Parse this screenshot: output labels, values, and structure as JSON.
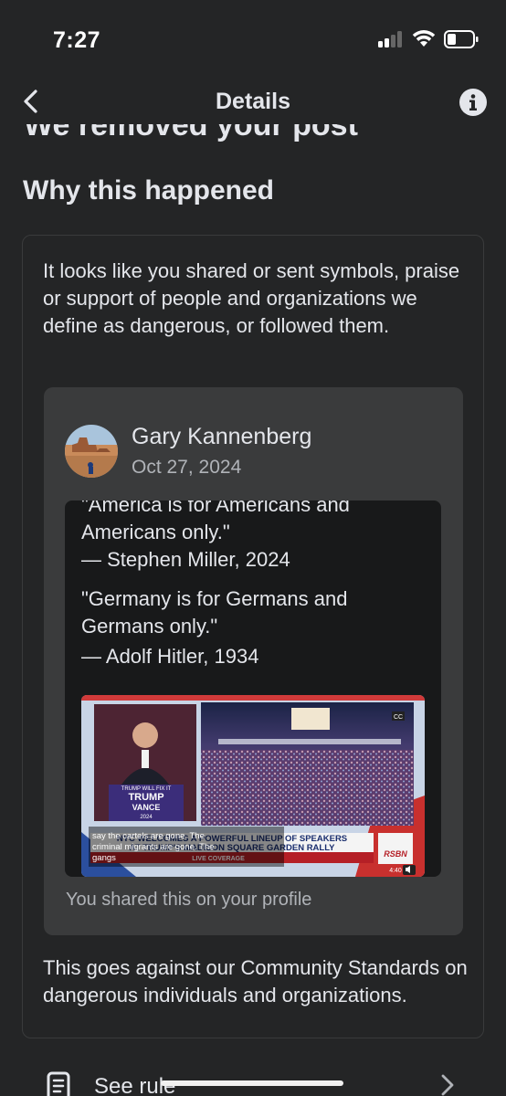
{
  "status_bar": {
    "time": "7:27",
    "signal_bars_active": 2,
    "signal_bars_total": 4,
    "battery_level": 0.3
  },
  "nav": {
    "title": "Details"
  },
  "clipped_heading": "We removed your post",
  "section": {
    "heading": "Why this happened"
  },
  "reason": "It looks like you shared or sent symbols, praise or support of people and organizations we define as dangerous, or followed them.",
  "post": {
    "author": "Gary Kannenberg",
    "date": "Oct 27, 2024",
    "quote_lines": [
      "\"America is for Americans and",
      "Americans only.\"",
      "— Stephen Miller, 2024",
      "\"Germany is for Germans and",
      "Germans only.\"",
      "— Adolf Hitler, 1934"
    ],
    "video": {
      "caption": "say the cartels are gone. The criminal migrants are gone. The gangs",
      "banner_line1": "NYC WELCOMES A POWERFUL LINEUP OF SPEAKERS",
      "banner_line2": "AT TRUMP'S MADISON SQUARE GARDEN RALLY",
      "live_label": "LIVE COVERAGE",
      "network": "RSBN",
      "timer": "4:40",
      "cc_label": "CC",
      "sign_line1": "TRUMP WILL FIX IT",
      "sign_line2": "TRUMP",
      "sign_line3": "VANCE",
      "sign_line4": "2024"
    },
    "shared_note": "You shared this on your profile"
  },
  "against": "This goes against our Community Standards on dangerous individuals and organizations.",
  "see_rule": {
    "label": "See rule"
  },
  "colors": {
    "background": "#242526",
    "card_border": "#3a3b3c",
    "post_bg": "#3a3b3c",
    "shared_bg": "#18191a",
    "text": "#e4e6eb",
    "muted": "#b0b3b8"
  }
}
